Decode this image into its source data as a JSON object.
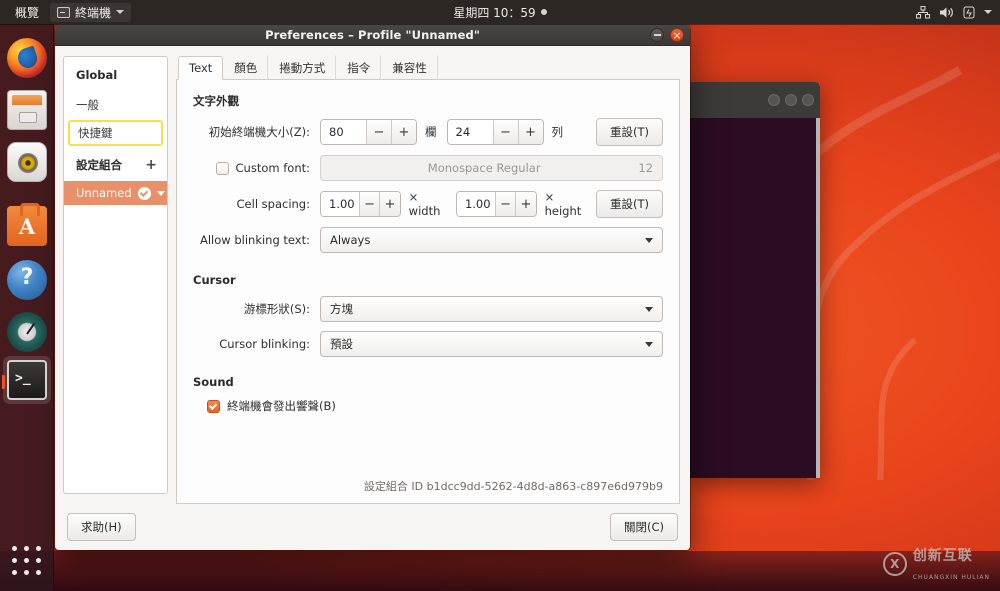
{
  "topbar": {
    "activities": "概覽",
    "app_name": "終端機",
    "app_icon": "terminal-icon",
    "clock": "星期四 10：59",
    "tray": [
      "network-icon",
      "volume-icon",
      "power-icon",
      "chevron-down-icon"
    ]
  },
  "dock": {
    "items": [
      {
        "name": "firefox",
        "label": "Firefox"
      },
      {
        "name": "files",
        "label": "Files"
      },
      {
        "name": "rhythmbox",
        "label": "Rhythmbox"
      },
      {
        "name": "ubuntu-software",
        "label": "Ubuntu Software"
      },
      {
        "name": "help",
        "label": "Help"
      },
      {
        "name": "disk-usage-analyzer",
        "label": "Disk Usage Analyzer"
      },
      {
        "name": "terminal",
        "label": "終端機"
      }
    ],
    "show_apps_label": "Show Applications"
  },
  "window": {
    "title": "Preferences – Profile \"Unnamed\"",
    "minimize_icon": "minimize-icon",
    "close_icon": "close-icon"
  },
  "sidebar": {
    "global_header": "Global",
    "general_item": "一般",
    "shortcuts_item": "快捷鍵",
    "profiles_header": "設定組合",
    "add_symbol": "+",
    "profile_name": "Unnamed",
    "help_button": "求助(H)"
  },
  "tabs": [
    {
      "label": "Text",
      "active": true
    },
    {
      "label": "顏色",
      "active": false
    },
    {
      "label": "捲動方式",
      "active": false
    },
    {
      "label": "指令",
      "active": false
    },
    {
      "label": "兼容性",
      "active": false
    }
  ],
  "text_section": {
    "heading": "文字外觀",
    "initial_size_label": "初始終端機大小(Z):",
    "columns_value": "80",
    "columns_unit": "欄",
    "rows_value": "24",
    "rows_unit": "列",
    "reset_size": "重設(T)",
    "custom_font_label": "Custom font:",
    "custom_font_checked": false,
    "font_name": "Monospace Regular",
    "font_size": "12",
    "cell_spacing_label": "Cell spacing:",
    "cell_width_value": "1.00",
    "cell_width_unit": "× width",
    "cell_height_value": "1.00",
    "cell_height_unit": "× height",
    "reset_spacing": "重設(T)",
    "blinking_label": "Allow blinking text:",
    "blinking_value": "Always",
    "minus": "−",
    "plus": "+"
  },
  "cursor_section": {
    "heading": "Cursor",
    "shape_label": "游標形狀(S):",
    "shape_value": "方塊",
    "blink_label": "Cursor blinking:",
    "blink_value": "預設"
  },
  "sound_section": {
    "heading": "Sound",
    "bell_label": "終端機會發出響聲(B)",
    "bell_checked": true
  },
  "footer": {
    "profile_id": "設定組合 ID b1dcc9dd-5262-4d8d-a863-c897e6d979b9",
    "close_button": "關閉(C)"
  },
  "watermark": {
    "cn": "创新互联",
    "en": "CHUANGXIN HULIAN"
  },
  "colors": {
    "accent": "#e95420",
    "selection": "#e8906a",
    "focus_ring": "#f7e14a",
    "titlebar": "#3b3734",
    "panel": "#fdfdfd"
  }
}
